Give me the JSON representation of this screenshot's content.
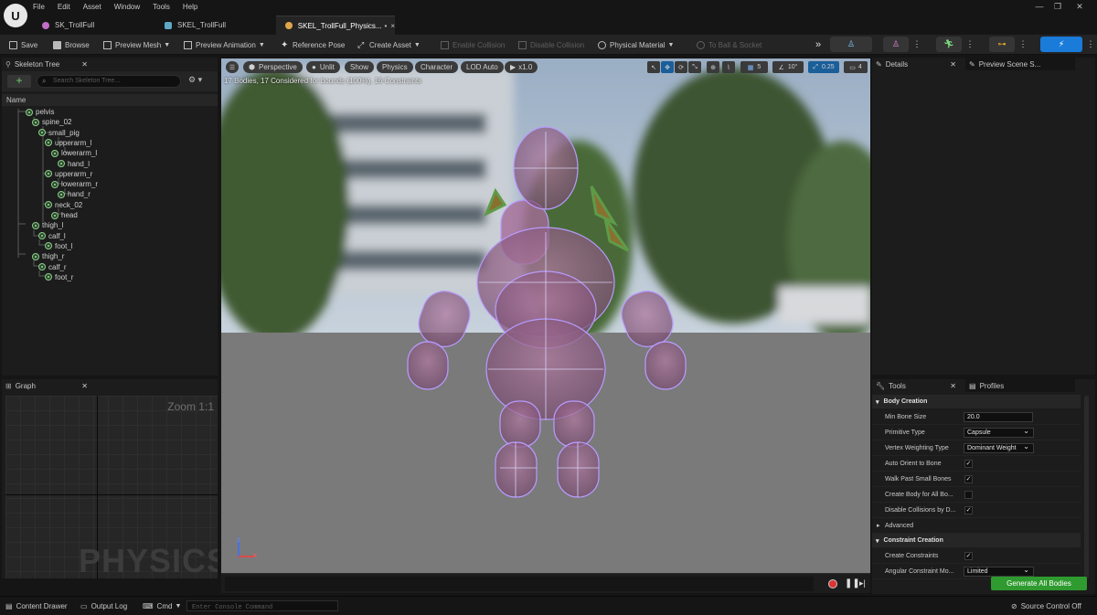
{
  "menu": [
    "File",
    "Edit",
    "Asset",
    "Window",
    "Tools",
    "Help"
  ],
  "tabs": [
    {
      "label": "SK_TrollFull",
      "color": "#c06ec7"
    },
    {
      "label": "SKEL_TrollFull",
      "color": "#5fa8c4"
    },
    {
      "label": "SKEL_TrollFull_Physics...",
      "color": "#e0a64b",
      "dirty": "•",
      "close": "×"
    }
  ],
  "toolbar": {
    "save": "Save",
    "browse": "Browse",
    "preview_mesh": "Preview Mesh",
    "preview_animation": "Preview Animation",
    "reference_pose": "Reference Pose",
    "create_asset": "Create Asset",
    "enable_collision": "Enable Collision",
    "disable_collision": "Disable Collision",
    "physical_material": "Physical Material",
    "to_ball_socket": "To Ball & Socket"
  },
  "skeleton_tree": {
    "title": "Skeleton Tree",
    "search_placeholder": "Search Skeleton Tree...",
    "column": "Name",
    "bones": [
      {
        "name": "pelvis",
        "depth": 0
      },
      {
        "name": "spine_02",
        "depth": 1
      },
      {
        "name": "small_pig",
        "depth": 2
      },
      {
        "name": "upperarm_l",
        "depth": 3
      },
      {
        "name": "lowerarm_l",
        "depth": 4
      },
      {
        "name": "hand_l",
        "depth": 5
      },
      {
        "name": "upperarm_r",
        "depth": 3
      },
      {
        "name": "lowerarm_r",
        "depth": 4
      },
      {
        "name": "hand_r",
        "depth": 5
      },
      {
        "name": "neck_02",
        "depth": 3
      },
      {
        "name": "head",
        "depth": 4
      },
      {
        "name": "thigh_l",
        "depth": 1
      },
      {
        "name": "calf_l",
        "depth": 2
      },
      {
        "name": "foot_l",
        "depth": 3
      },
      {
        "name": "thigh_r",
        "depth": 1
      },
      {
        "name": "calf_r",
        "depth": 2
      },
      {
        "name": "foot_r",
        "depth": 3
      }
    ]
  },
  "graph": {
    "title": "Graph",
    "zoom": "Zoom 1:1",
    "watermark": "PHYSICS"
  },
  "viewport": {
    "perspective": "Perspective",
    "unlit": "Unlit",
    "show": "Show",
    "physics": "Physics",
    "character": "Character",
    "lod": "LOD Auto",
    "speed": "x1.0",
    "stats": "17 Bodies, 17 Considered for bounds (100%), 16 Constraints",
    "grid_size": "5",
    "angle": "10°",
    "scale": "0.25",
    "camera_speed": "4",
    "axis_z": "z",
    "axis_x": "x"
  },
  "details": {
    "tab": "Details",
    "preview_tab": "Preview Scene S..."
  },
  "tools": {
    "tab": "Tools",
    "profiles_tab": "Profiles",
    "body_creation": "Body Creation",
    "min_bone_size_label": "Min Bone Size",
    "min_bone_size": "20.0",
    "primitive_type_label": "Primitive Type",
    "primitive_type": "Capsule",
    "vertex_weighting_label": "Vertex Weighting Type",
    "vertex_weighting": "Dominant Weight",
    "auto_orient_label": "Auto Orient to Bone",
    "auto_orient": true,
    "walk_past_label": "Walk Past Small Bones",
    "walk_past": true,
    "create_body_all_label": "Create Body for All Bo...",
    "create_body_all": false,
    "disable_collisions_label": "Disable Collisions by D...",
    "disable_collisions": true,
    "advanced": "Advanced",
    "constraint_creation": "Constraint Creation",
    "create_constraints_label": "Create Constraints",
    "create_constraints": true,
    "angular_label": "Angular Constraint Mo...",
    "angular": "Limited",
    "generate": "Generate All Bodies"
  },
  "statusbar": {
    "content_drawer": "Content Drawer",
    "output_log": "Output Log",
    "cmd": "Cmd",
    "console_placeholder": "Enter Console Command",
    "source_control": "Source Control Off"
  },
  "colors": {
    "accent": "#1a7bd9",
    "generate": "#2f9a2f",
    "bone": "#8bcf8b"
  }
}
